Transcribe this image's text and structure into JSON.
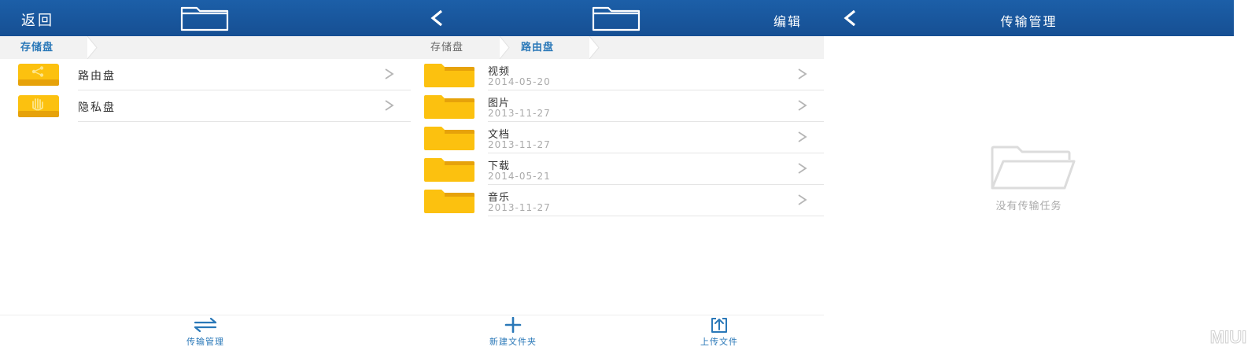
{
  "panel1": {
    "back_label": "返回",
    "breadcrumb": [
      "存储盘"
    ],
    "drives": [
      {
        "label": "路由盘",
        "icon": "share-drive-icon"
      },
      {
        "label": "隐私盘",
        "icon": "hand-drive-icon"
      }
    ],
    "bottom": {
      "transfer_label": "传输管理"
    }
  },
  "panel2": {
    "edit_label": "编辑",
    "breadcrumb": [
      "存储盘",
      "路由盘"
    ],
    "folders": [
      {
        "name": "视频",
        "date": "2014-05-20"
      },
      {
        "name": "图片",
        "date": "2013-11-27"
      },
      {
        "name": "文档",
        "date": "2013-11-27"
      },
      {
        "name": "下载",
        "date": "2014-05-21"
      },
      {
        "name": "音乐",
        "date": "2013-11-27"
      }
    ],
    "bottom": {
      "new_folder_label": "新建文件夹",
      "upload_label": "上传文件"
    }
  },
  "panel3": {
    "title": "传输管理",
    "empty_text": "没有传输任务"
  },
  "watermark": "MIUI",
  "colors": {
    "topbar": "#164f93",
    "accent": "#2a78b8",
    "folder": "#fcc10f",
    "folder_dark": "#e6a20a",
    "muted_text": "#aaaaaa"
  }
}
